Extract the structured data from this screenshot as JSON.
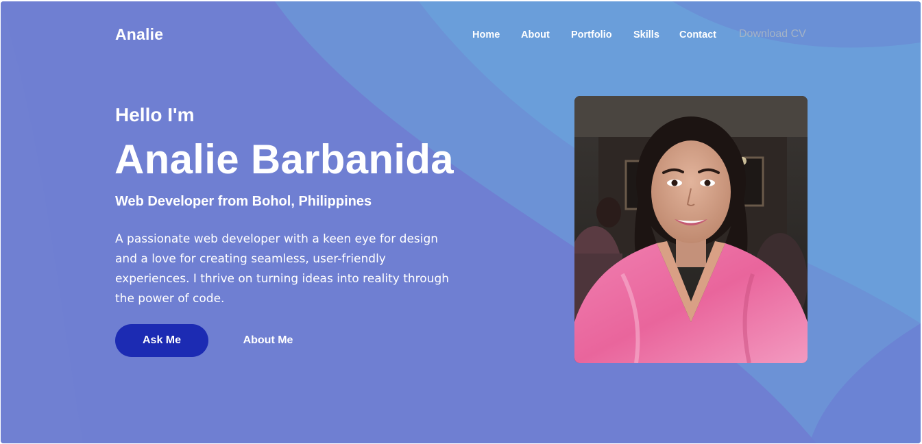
{
  "brand": {
    "logo": "Analie"
  },
  "nav": {
    "home": "Home",
    "about": "About",
    "portfolio": "Portfolio",
    "skills": "Skills",
    "contact": "Contact",
    "download_cv": "Download CV"
  },
  "hero": {
    "greeting": "Hello I'm",
    "name": "Analie Barbanida",
    "role": "Web Developer from Bohol, Philippines",
    "bio": "A passionate web developer with a keen eye for design and a love for creating seamless, user-friendly experiences. I thrive on turning ideas into reality through the power of code.",
    "primary_button": "Ask Me",
    "secondary_button": "About Me"
  },
  "colors": {
    "background": "#6f7fd2",
    "background_accent": "#6a9fd8",
    "primary_button": "#1c2bb3",
    "muted_link": "#a4b3c6",
    "robe": "#ec6fa3"
  }
}
